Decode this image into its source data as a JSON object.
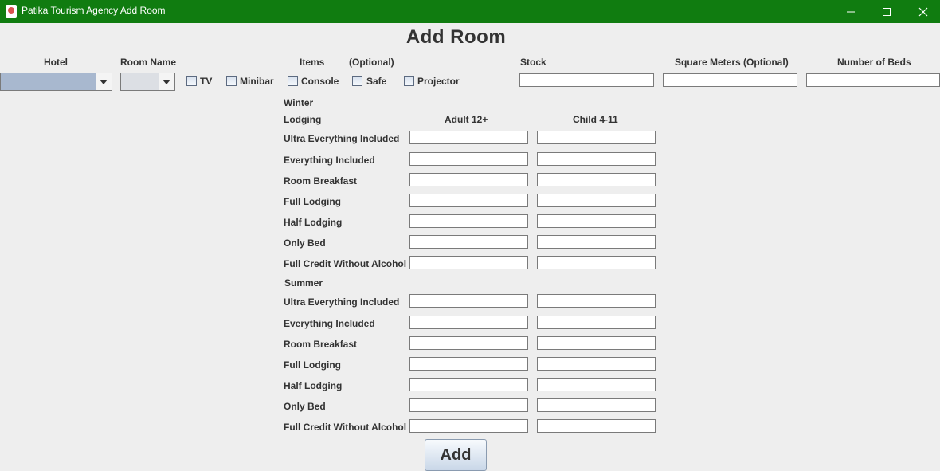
{
  "window": {
    "title": "Patika Tourism Agency Add Room",
    "controls": [
      "minimize-icon",
      "maximize-icon",
      "close-icon"
    ]
  },
  "heading": "Add Room",
  "header_labels": {
    "hotel": "Hotel",
    "room_name": "Room Name",
    "items": "Items",
    "optional": "(Optional)",
    "stock": "Stock",
    "square_meters": "Square Meters (Optional)",
    "number_of_beds": "Number of Beds"
  },
  "hotel_select": {
    "value": ""
  },
  "room_select": {
    "value": ""
  },
  "items": [
    {
      "label": "TV",
      "checked": false
    },
    {
      "label": "Minibar",
      "checked": false
    },
    {
      "label": "Console",
      "checked": false
    },
    {
      "label": "Safe",
      "checked": false
    },
    {
      "label": "Projector",
      "checked": false
    }
  ],
  "inputs": {
    "stock": "",
    "square_meters": "",
    "number_of_beds": ""
  },
  "price_columns": {
    "lodging": "Lodging",
    "adult": "Adult 12+",
    "child": "Child 4-11"
  },
  "winter": {
    "label": "Winter",
    "rows": [
      {
        "label": "Ultra Everything Included",
        "adult": "",
        "child": ""
      },
      {
        "label": "Everything Included",
        "adult": "",
        "child": ""
      },
      {
        "label": "Room Breakfast",
        "adult": "",
        "child": ""
      },
      {
        "label": "Full Lodging",
        "adult": "",
        "child": ""
      },
      {
        "label": "Half Lodging",
        "adult": "",
        "child": ""
      },
      {
        "label": "Only Bed",
        "adult": "",
        "child": ""
      },
      {
        "label": "Full Credit Without Alcohol",
        "adult": "",
        "child": ""
      }
    ]
  },
  "summer": {
    "label": "Summer",
    "rows": [
      {
        "label": "Ultra Everything Included",
        "adult": "",
        "child": ""
      },
      {
        "label": "Everything Included",
        "adult": "",
        "child": ""
      },
      {
        "label": "Room Breakfast",
        "adult": "",
        "child": ""
      },
      {
        "label": "Full Lodging",
        "adult": "",
        "child": ""
      },
      {
        "label": "Half Lodging",
        "adult": "",
        "child": ""
      },
      {
        "label": "Only Bed",
        "adult": "",
        "child": ""
      },
      {
        "label": "Full Credit Without Alcohol",
        "adult": "",
        "child": ""
      }
    ]
  },
  "add_button": "Add",
  "colors": {
    "titlebar": "#107c10",
    "background": "#eeeeee",
    "hotel_combo": "#a8b8cf"
  }
}
